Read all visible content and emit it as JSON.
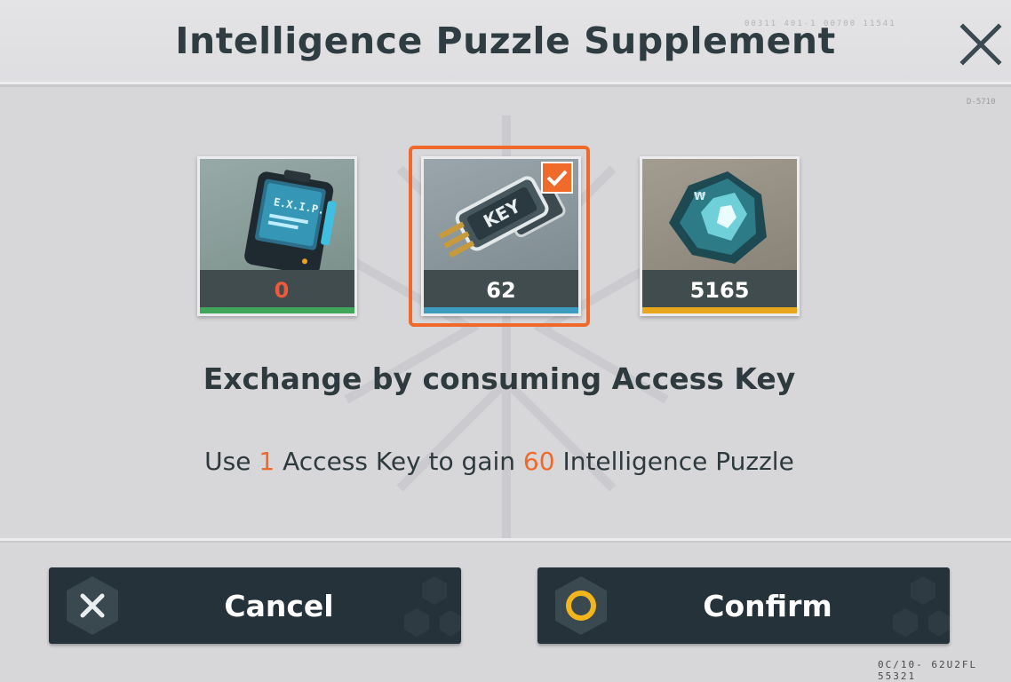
{
  "dialog": {
    "title": "Intelligence Puzzle Supplement",
    "close_icon": "close-icon",
    "code_top": "00311  401-1  00700  11541",
    "code_side": "D-5710",
    "code_bottom": "0C/10- 62U2FL 55321"
  },
  "items": [
    {
      "name": "Intelligence Module",
      "icon": "data-card-icon",
      "count": "0",
      "stripe_color": "#3fa65a",
      "selected": false
    },
    {
      "name": "Access Key",
      "icon": "access-key-icon",
      "count": "62",
      "stripe_color": "#3b9cc0",
      "selected": true
    },
    {
      "name": "Crystal",
      "icon": "crystal-icon",
      "count": "5165",
      "stripe_color": "#e8a71c",
      "selected": false
    }
  ],
  "exchange": {
    "title": "Exchange by consuming Access Key",
    "desc_prefix": "Use ",
    "cost_amount": "1",
    "desc_middle": " Access Key to gain ",
    "gain_amount": "60",
    "desc_suffix": " Intelligence Puzzle"
  },
  "buttons": {
    "cancel": "Cancel",
    "confirm": "Confirm"
  },
  "colors": {
    "accent": "#f0682a",
    "button_bg": "#26323a",
    "panel_bg": "#d7d7da"
  }
}
